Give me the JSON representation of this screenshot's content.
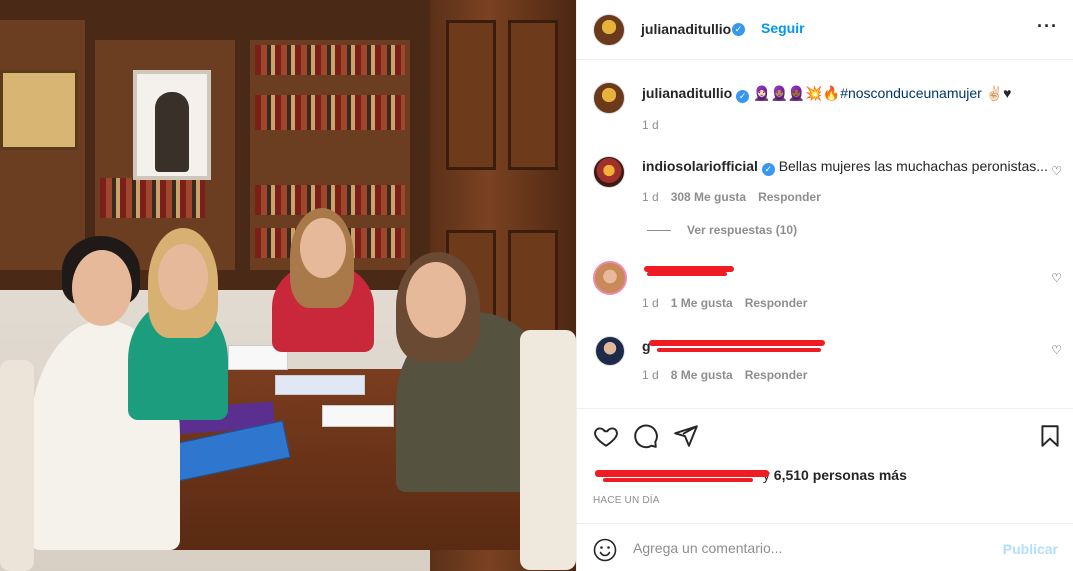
{
  "post": {
    "photo_alt": "Cuatro mujeres sentadas alrededor de una mesa de madera en una oficina con biblioteca"
  },
  "header": {
    "username": "julianaditullio",
    "separator": "•",
    "follow_label": "Seguir",
    "more_label": "···"
  },
  "caption": {
    "username": "julianaditullio",
    "emojis": "🧕🏻🧕🏽🧕🏾💥🔥",
    "hashtag": "#nosconduceunamujer",
    "trailing_emojis": "✌🏻♥",
    "time": "1 d"
  },
  "comments": [
    {
      "username": "indiosolariofficial",
      "verified": true,
      "text": "Bellas mujeres las muchachas peronistas...",
      "time": "1 d",
      "likes": "308 Me gusta",
      "reply_label": "Responder",
      "view_replies": "Ver respuestas (10)"
    },
    {
      "username": "",
      "redacted": true,
      "text": "",
      "time": "1 d",
      "likes": "1 Me gusta",
      "reply_label": "Responder"
    },
    {
      "username": "g",
      "redacted": true,
      "text": "",
      "time": "1 d",
      "likes": "8 Me gusta",
      "reply_label": "Responder"
    }
  ],
  "actions": {
    "likes_suffix": "y",
    "likes_count": "6,510 personas más",
    "time_ago": "HACE UN DÍA"
  },
  "add_comment": {
    "placeholder": "Agrega un comentario...",
    "publish_label": "Publicar"
  },
  "colors": {
    "link_blue": "#0095f6",
    "verified_blue": "#3897f0",
    "hashtag": "#00376b",
    "muted": "#8e8e8e",
    "redaction": "#ef1c24",
    "publish_disabled": "#b2dffc"
  }
}
